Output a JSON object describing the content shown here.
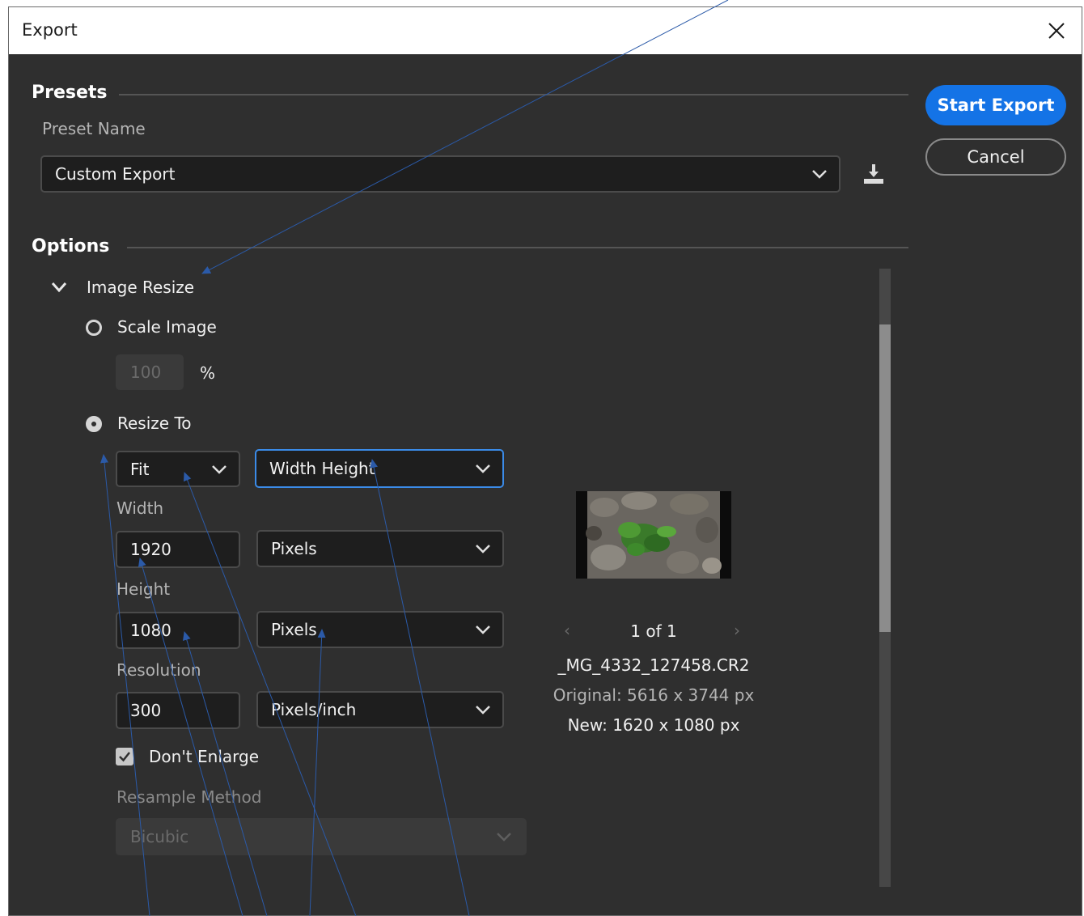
{
  "dialog": {
    "title": "Export",
    "close_icon": "close-icon"
  },
  "presets": {
    "header": "Presets",
    "preset_name_label": "Preset Name",
    "preset_selected": "Custom Export",
    "save_icon": "save-preset-icon"
  },
  "actions": {
    "start_export": "Start Export",
    "cancel": "Cancel"
  },
  "options": {
    "header": "Options",
    "image_resize": {
      "label": "Image Resize",
      "expanded": true,
      "scale_image": {
        "label": "Scale Image",
        "selected": false,
        "value": "100",
        "unit": "%"
      },
      "resize_to": {
        "label": "Resize To",
        "selected": true,
        "mode": "Fit",
        "dimension": "Width Height",
        "width_label": "Width",
        "width_value": "1920",
        "width_unit": "Pixels",
        "height_label": "Height",
        "height_value": "1080",
        "height_unit": "Pixels",
        "resolution_label": "Resolution",
        "resolution_value": "300",
        "resolution_unit": "Pixels/inch",
        "dont_enlarge_label": "Don't Enlarge",
        "dont_enlarge_checked": true,
        "resample_label": "Resample Method",
        "resample_value": "Bicubic"
      }
    }
  },
  "preview": {
    "page_indicator": "1 of 1",
    "filename": "_MG_4332_127458.CR2",
    "original": "Original: 5616 x 3744 px",
    "new": "New: 1620 x 1080 px"
  },
  "colors": {
    "dialog_bg": "#2f2f2f",
    "accent": "#1473e6",
    "focus_border": "#3b8be8",
    "annotation_line": "#2b5aa8"
  }
}
